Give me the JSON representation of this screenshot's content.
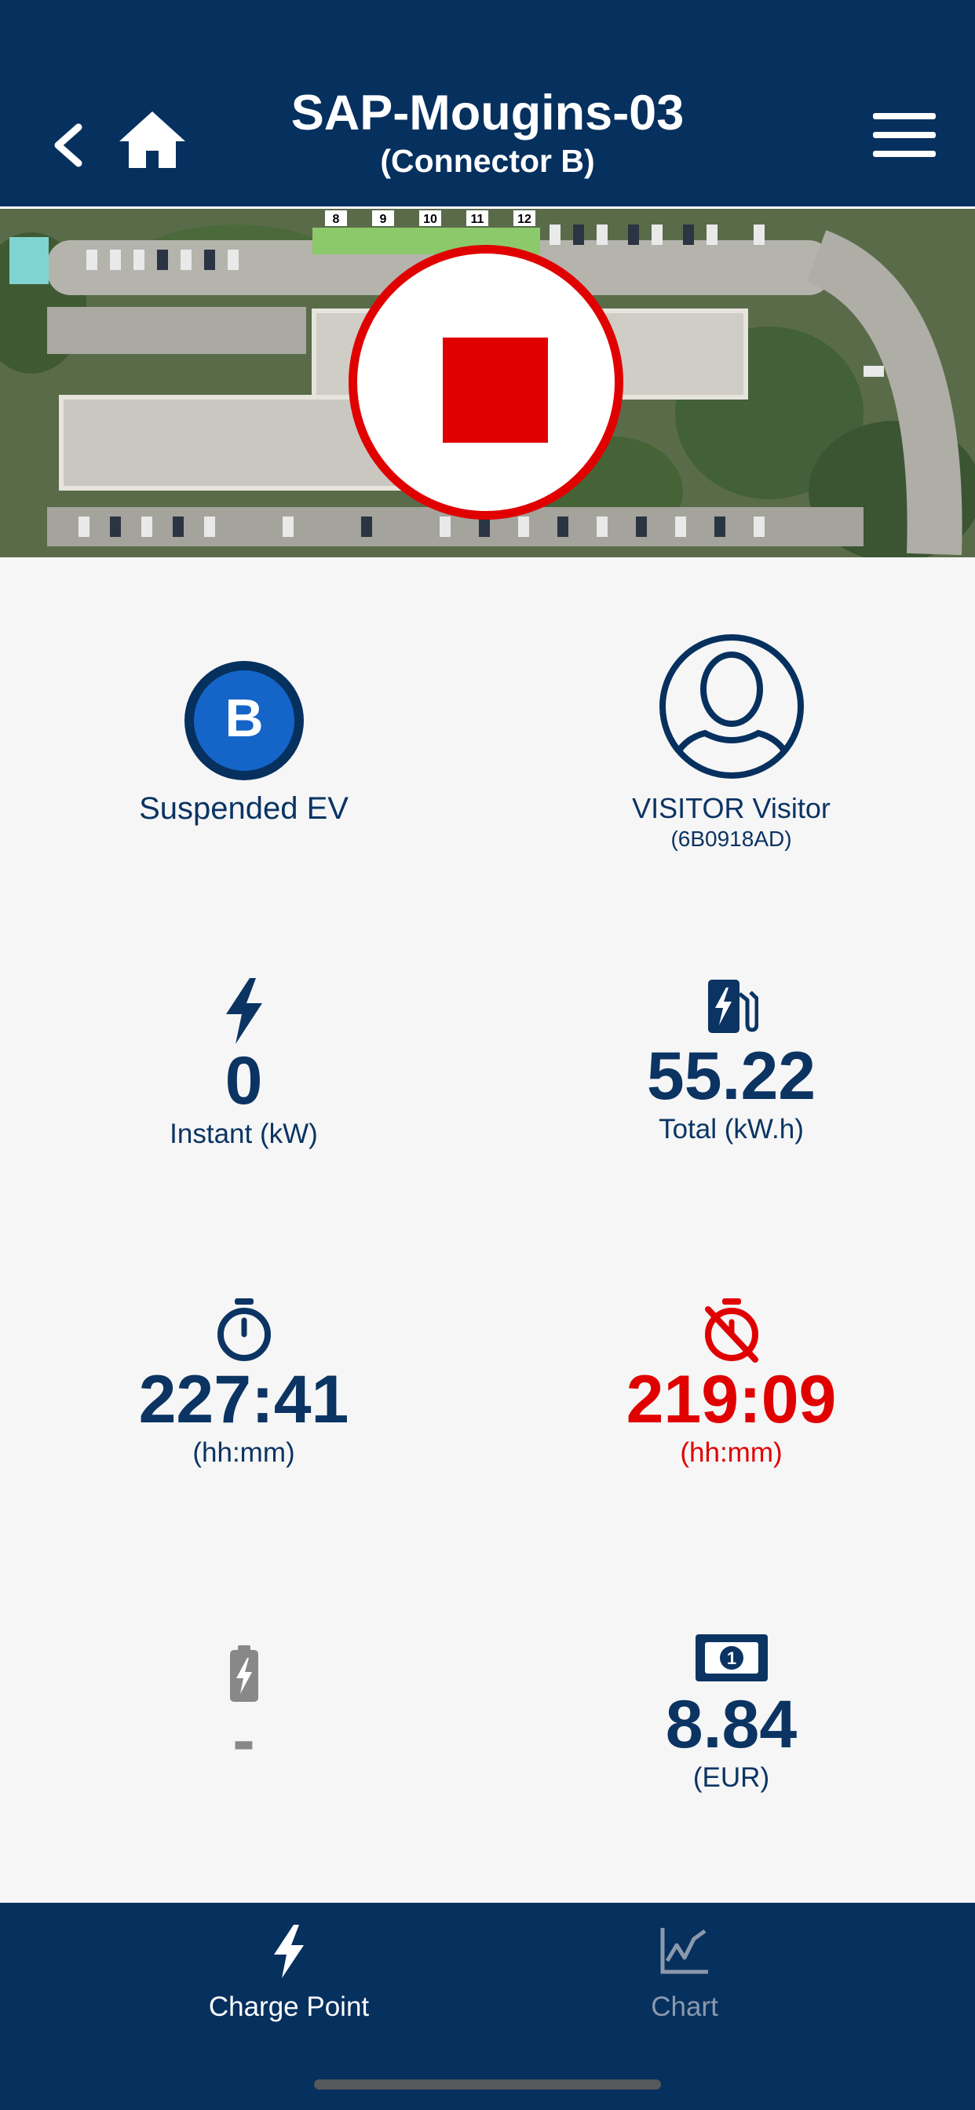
{
  "header": {
    "title": "SAP-Mougins-03",
    "subtitle": "(Connector B)",
    "back_icon": "chevron-left-icon",
    "home_icon": "home-icon",
    "menu_icon": "hamburger-menu-icon"
  },
  "map": {
    "spot_numbers": [
      "8",
      "9",
      "10",
      "11",
      "12"
    ],
    "stop_button_icon": "stop-square-icon"
  },
  "connector": {
    "letter": "B",
    "status": "Suspended EV"
  },
  "user": {
    "name": "VISITOR Visitor",
    "tag": "(6B0918AD)",
    "icon": "user-avatar-icon"
  },
  "metrics": {
    "instant": {
      "value": "0",
      "label": "Instant (kW)",
      "icon": "bolt-icon"
    },
    "total": {
      "value": "55.22",
      "label": "Total (kW.h)",
      "icon": "charging-station-icon"
    },
    "duration": {
      "value": "227:41",
      "label": "(hh:mm)",
      "icon": "stopwatch-icon"
    },
    "inactivity": {
      "value": "219:09",
      "label": "(hh:mm)",
      "icon": "stopwatch-off-icon"
    },
    "battery": {
      "value": "-",
      "icon": "battery-charging-icon"
    },
    "price": {
      "value": "8.84",
      "label": "(EUR)",
      "icon": "money-bill-icon"
    }
  },
  "colors": {
    "primary": "#06305e",
    "text": "#0b3463",
    "alert": "#e00000",
    "connector_badge": "#1565c8"
  },
  "tabs": [
    {
      "label": "Charge Point",
      "icon": "bolt-icon",
      "active": true
    },
    {
      "label": "Chart",
      "icon": "line-chart-icon",
      "active": false
    }
  ]
}
